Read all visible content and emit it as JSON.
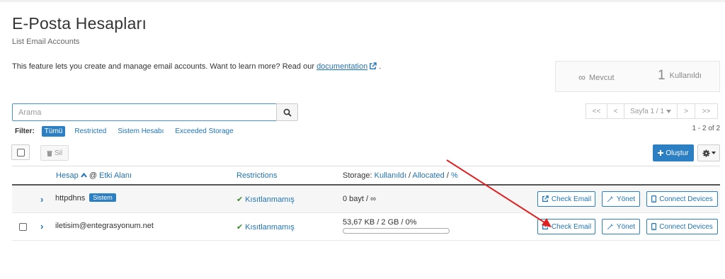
{
  "page": {
    "title": "E-Posta Hesapları",
    "subtitle": "List Email Accounts",
    "description_text": "This feature lets you create and manage email accounts. Want to learn more? Read our",
    "documentation_link": "documentation",
    "description_suffix": "."
  },
  "stats": {
    "available_symbol": "∞",
    "available_label": "Mevcut",
    "used_count": "1",
    "used_label": "Kullanıldı"
  },
  "search": {
    "placeholder": "Arama",
    "value": ""
  },
  "filter": {
    "label": "Filter:",
    "options": [
      "Tümü",
      "Restricted",
      "Sistem Hesabı",
      "Exceeded Storage"
    ],
    "active": "Tümü"
  },
  "pagination": {
    "first": "<<",
    "prev": "<",
    "page_label": "Sayfa 1 / 1",
    "next": ">",
    "last": ">>",
    "count": "1 - 2 of 2"
  },
  "toolbar": {
    "delete_label": "Sil",
    "create_label": "Oluştur"
  },
  "table": {
    "headers": {
      "account": "Hesap",
      "at": "@",
      "domain": "Etki Alanı",
      "restrictions": "Restrictions",
      "storage_prefix": "Storage:",
      "used": "Kullanıldı",
      "sep1": "/",
      "allocated": "Allocated",
      "sep2": "/",
      "percent": "%"
    },
    "rows": [
      {
        "account": "httpdhns",
        "badge": "Sistem",
        "restriction": "Kısıtlanmamış",
        "storage": "0 bayt / ∞",
        "usage_fraction": 0
      },
      {
        "account": "iletisim@entegrasyonum.net",
        "badge": "",
        "restriction": "Kısıtlanmamış",
        "storage": "53,67 KB / 2 GB / 0%",
        "usage_fraction": 0
      }
    ],
    "actions": {
      "check_email": "Check Email",
      "manage": "Yönet",
      "connect_devices": "Connect Devices"
    }
  },
  "colors": {
    "primary": "#2c7fc2",
    "link": "#1f74b6",
    "success": "#3c8a2e",
    "annotation_arrow": "#e02020"
  }
}
